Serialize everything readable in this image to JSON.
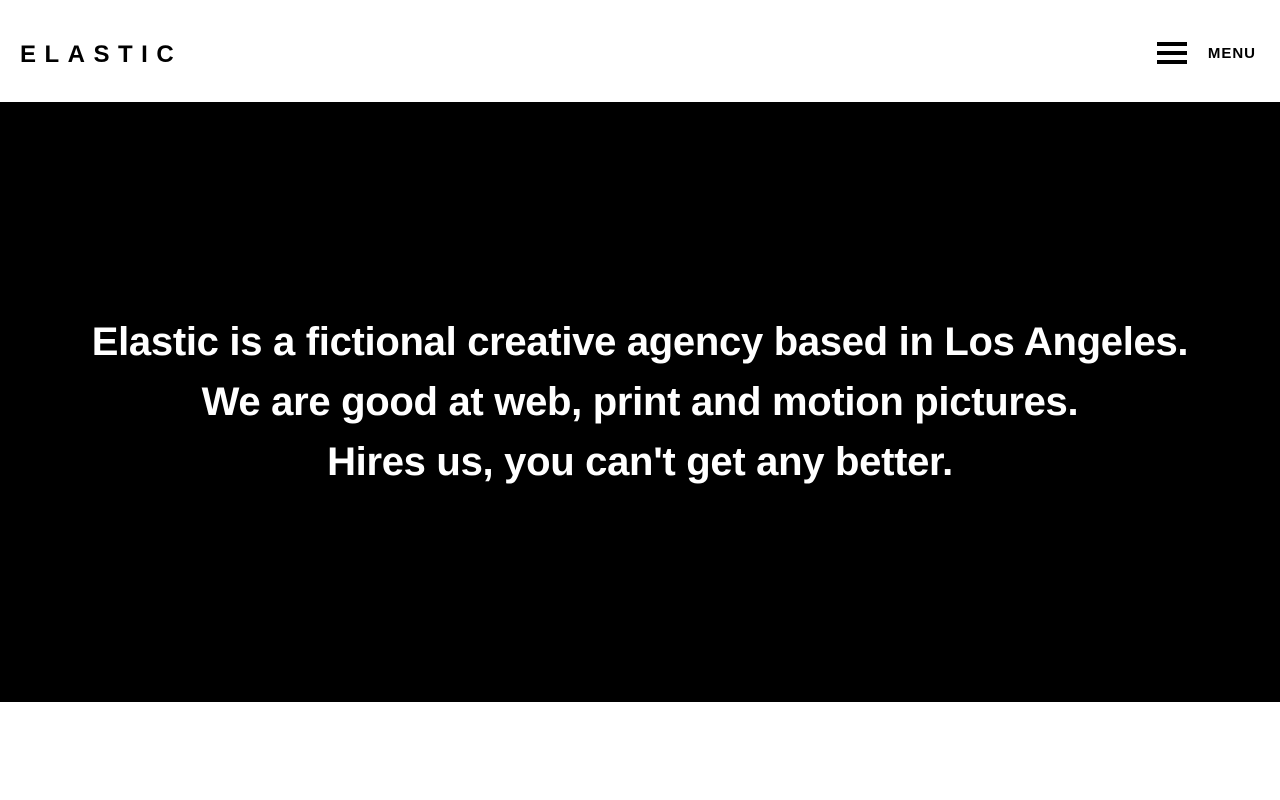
{
  "header": {
    "logo_text": "ELASTIC",
    "menu_label": "MENU",
    "menu_icon": "hamburger-icon"
  },
  "hero": {
    "lines": [
      "Elastic is a fictional creative agency based in Los Angeles.",
      "We are good at web, print and motion pictures.",
      "Hires us, you can't get any better."
    ]
  },
  "colors": {
    "page_background": "#ffffff",
    "hero_background": "#000000",
    "hero_text": "#ffffff",
    "header_text": "#000000"
  }
}
